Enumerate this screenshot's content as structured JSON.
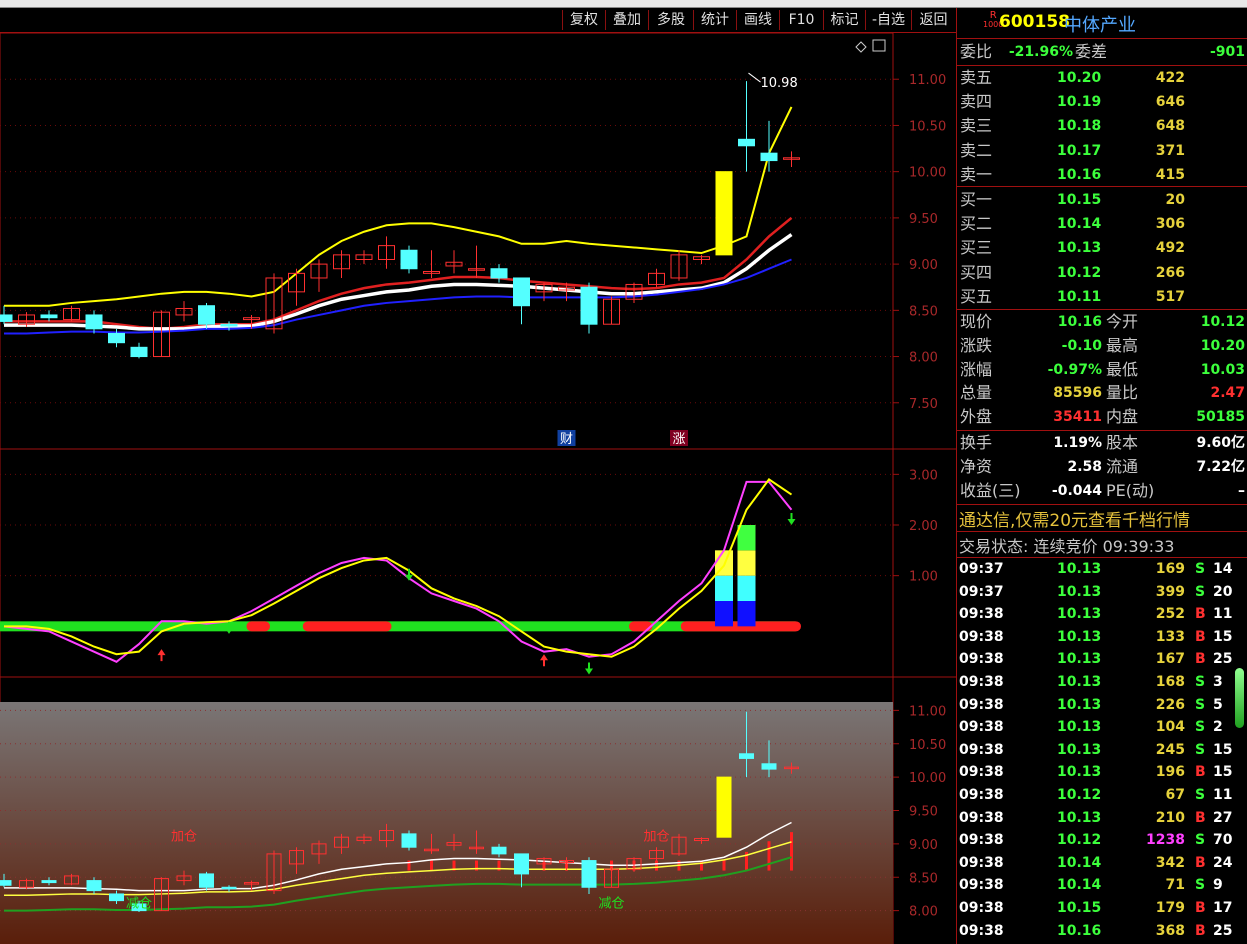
{
  "toolbar": [
    {
      "key": "fuquan",
      "label": "复权"
    },
    {
      "key": "diejia",
      "label": "叠加"
    },
    {
      "key": "duogu",
      "label": "多股"
    },
    {
      "key": "tongji",
      "label": "统计"
    },
    {
      "key": "huaxian",
      "label": "画线"
    },
    {
      "key": "f10",
      "label": "F10"
    },
    {
      "key": "biaoji",
      "label": "标记"
    },
    {
      "key": "zixuan",
      "label": "-自选"
    },
    {
      "key": "fanhui",
      "label": "返回"
    }
  ],
  "stock": {
    "badge_top": "R",
    "badge_bottom": "1000",
    "code": "600158",
    "name": "中体产业"
  },
  "weibi": {
    "label": "委比",
    "value": "-21.96%",
    "label2": "委差",
    "value2": "-901"
  },
  "asks": [
    {
      "label": "卖五",
      "price": "10.20",
      "vol": "422"
    },
    {
      "label": "卖四",
      "price": "10.19",
      "vol": "646"
    },
    {
      "label": "卖三",
      "price": "10.18",
      "vol": "648"
    },
    {
      "label": "卖二",
      "price": "10.17",
      "vol": "371"
    },
    {
      "label": "卖一",
      "price": "10.16",
      "vol": "415"
    }
  ],
  "bids": [
    {
      "label": "买一",
      "price": "10.15",
      "vol": "20"
    },
    {
      "label": "买二",
      "price": "10.14",
      "vol": "306"
    },
    {
      "label": "买三",
      "price": "10.13",
      "vol": "492"
    },
    {
      "label": "买四",
      "price": "10.12",
      "vol": "266"
    },
    {
      "label": "买五",
      "price": "10.11",
      "vol": "517"
    }
  ],
  "quote": [
    {
      "l1": "现价",
      "v1": "10.16",
      "c1": "#3cff3c",
      "l2": "今开",
      "v2": "10.12",
      "c2": "#3cff3c"
    },
    {
      "l1": "涨跌",
      "v1": "-0.10",
      "c1": "#3cff3c",
      "l2": "最高",
      "v2": "10.20",
      "c2": "#3cff3c"
    },
    {
      "l1": "涨幅",
      "v1": "-0.97%",
      "c1": "#3cff3c",
      "l2": "最低",
      "v2": "10.03",
      "c2": "#3cff3c"
    },
    {
      "l1": "总量",
      "v1": "85596",
      "c1": "#e6d23c",
      "l2": "量比",
      "v2": "2.47",
      "c2": "#ff3030"
    },
    {
      "l1": "外盘",
      "v1": "35411",
      "c1": "#ff3030",
      "l2": "内盘",
      "v2": "50185",
      "c2": "#3cff3c"
    }
  ],
  "fundamentals": [
    {
      "l1": "换手",
      "v1": "1.19%",
      "l2": "股本",
      "v2": "9.60亿"
    },
    {
      "l1": "净资",
      "v1": "2.58",
      "l2": "流通",
      "v2": "7.22亿"
    },
    {
      "l1": "收益(三)",
      "v1": "-0.044",
      "l2": "PE(动)",
      "v2": "–"
    }
  ],
  "promo": "通达信,仅需20元查看千档行情",
  "trade_status": "交易状态: 连续竞价 09:39:33",
  "ticks": [
    {
      "t": "09:37",
      "p": "10.13",
      "v": "169",
      "s": "S",
      "n": "14"
    },
    {
      "t": "09:37",
      "p": "10.13",
      "v": "399",
      "s": "S",
      "n": "20"
    },
    {
      "t": "09:38",
      "p": "10.13",
      "v": "252",
      "s": "B",
      "n": "11"
    },
    {
      "t": "09:38",
      "p": "10.13",
      "v": "133",
      "s": "B",
      "n": "15"
    },
    {
      "t": "09:38",
      "p": "10.13",
      "v": "167",
      "s": "B",
      "n": "25"
    },
    {
      "t": "09:38",
      "p": "10.13",
      "v": "168",
      "s": "S",
      "n": "3"
    },
    {
      "t": "09:38",
      "p": "10.13",
      "v": "226",
      "s": "S",
      "n": "5"
    },
    {
      "t": "09:38",
      "p": "10.13",
      "v": "104",
      "s": "S",
      "n": "2"
    },
    {
      "t": "09:38",
      "p": "10.13",
      "v": "245",
      "s": "S",
      "n": "15"
    },
    {
      "t": "09:38",
      "p": "10.13",
      "v": "196",
      "s": "B",
      "n": "15"
    },
    {
      "t": "09:38",
      "p": "10.12",
      "v": "67",
      "s": "S",
      "n": "11"
    },
    {
      "t": "09:38",
      "p": "10.13",
      "v": "210",
      "s": "B",
      "n": "27"
    },
    {
      "t": "09:38",
      "p": "10.12",
      "v": "1238",
      "s": "S",
      "n": "70"
    },
    {
      "t": "09:38",
      "p": "10.14",
      "v": "342",
      "s": "B",
      "n": "24"
    },
    {
      "t": "09:38",
      "p": "10.14",
      "v": "71",
      "s": "S",
      "n": "9"
    },
    {
      "t": "09:38",
      "p": "10.15",
      "v": "179",
      "s": "B",
      "n": "17"
    },
    {
      "t": "09:38",
      "p": "10.16",
      "v": "368",
      "s": "B",
      "n": "25"
    }
  ],
  "colors": {
    "up": "#ff3030",
    "down": "#3cff3c",
    "neutral": "#e6d23c",
    "label": "#c8c8c8",
    "grid_red": "#a01010",
    "cyan": "#54ffff",
    "yellow": "#ffff00",
    "magenta": "#ff40ff",
    "blue_vol": "#ff40ff"
  },
  "chart_data": [
    {
      "type": "candlestick",
      "panel": "main",
      "ylim": [
        7.0,
        11.5
      ],
      "yticks": [
        "11.00",
        "10.50",
        "10.00",
        "9.50",
        "9.00",
        "8.50",
        "8.00",
        "7.50"
      ],
      "max_label": "10.98",
      "event_labels": [
        {
          "label": "财",
          "index": 25
        },
        {
          "label": "涨",
          "index": 30
        }
      ],
      "candles": [
        {
          "o": 8.45,
          "h": 8.55,
          "l": 8.35,
          "c": 8.38
        },
        {
          "o": 8.35,
          "h": 8.48,
          "l": 8.32,
          "c": 8.45
        },
        {
          "o": 8.45,
          "h": 8.5,
          "l": 8.38,
          "c": 8.42
        },
        {
          "o": 8.4,
          "h": 8.55,
          "l": 8.38,
          "c": 8.52
        },
        {
          "o": 8.45,
          "h": 8.5,
          "l": 8.25,
          "c": 8.3
        },
        {
          "o": 8.25,
          "h": 8.3,
          "l": 8.1,
          "c": 8.15
        },
        {
          "o": 8.1,
          "h": 8.15,
          "l": 7.98,
          "c": 8.0
        },
        {
          "o": 8.0,
          "h": 8.5,
          "l": 8.0,
          "c": 8.48
        },
        {
          "o": 8.45,
          "h": 8.6,
          "l": 8.38,
          "c": 8.52
        },
        {
          "o": 8.55,
          "h": 8.58,
          "l": 8.3,
          "c": 8.35
        },
        {
          "o": 8.35,
          "h": 8.38,
          "l": 8.28,
          "c": 8.33
        },
        {
          "o": 8.4,
          "h": 8.45,
          "l": 8.3,
          "c": 8.42
        },
        {
          "o": 8.3,
          "h": 8.9,
          "l": 8.25,
          "c": 8.85
        },
        {
          "o": 8.7,
          "h": 8.95,
          "l": 8.55,
          "c": 8.9
        },
        {
          "o": 8.85,
          "h": 9.05,
          "l": 8.7,
          "c": 9.0
        },
        {
          "o": 8.95,
          "h": 9.15,
          "l": 8.85,
          "c": 9.1
        },
        {
          "o": 9.05,
          "h": 9.15,
          "l": 9.0,
          "c": 9.1
        },
        {
          "o": 9.05,
          "h": 9.3,
          "l": 8.95,
          "c": 9.2
        },
        {
          "o": 9.15,
          "h": 9.2,
          "l": 8.9,
          "c": 8.95
        },
        {
          "o": 8.9,
          "h": 9.15,
          "l": 8.85,
          "c": 8.92
        },
        {
          "o": 8.98,
          "h": 9.15,
          "l": 8.9,
          "c": 9.02
        },
        {
          "o": 8.95,
          "h": 9.2,
          "l": 8.85,
          "c": 8.95
        },
        {
          "o": 8.95,
          "h": 9.0,
          "l": 8.8,
          "c": 8.85
        },
        {
          "o": 8.85,
          "h": 8.8,
          "l": 8.35,
          "c": 8.55
        },
        {
          "o": 8.7,
          "h": 8.8,
          "l": 8.6,
          "c": 8.78
        },
        {
          "o": 8.72,
          "h": 8.8,
          "l": 8.6,
          "c": 8.75
        },
        {
          "o": 8.75,
          "h": 8.8,
          "l": 8.25,
          "c": 8.35
        },
        {
          "o": 8.35,
          "h": 8.65,
          "l": 8.35,
          "c": 8.62
        },
        {
          "o": 8.62,
          "h": 8.8,
          "l": 8.58,
          "c": 8.78
        },
        {
          "o": 8.78,
          "h": 8.95,
          "l": 8.75,
          "c": 8.9
        },
        {
          "o": 8.85,
          "h": 9.15,
          "l": 8.82,
          "c": 9.1
        },
        {
          "o": 9.05,
          "h": 9.1,
          "l": 9.0,
          "c": 9.08
        },
        {
          "o": 9.1,
          "h": 10.0,
          "l": 9.1,
          "c": 10.0
        },
        {
          "o": 10.35,
          "h": 10.98,
          "l": 10.0,
          "c": 10.28
        },
        {
          "o": 10.2,
          "h": 10.55,
          "l": 10.0,
          "c": 10.12
        },
        {
          "o": 10.15,
          "h": 10.22,
          "l": 10.05,
          "c": 10.15
        }
      ],
      "series": [
        {
          "name": "upper",
          "color": "#ffff00",
          "values": [
            8.55,
            8.55,
            8.55,
            8.58,
            8.6,
            8.62,
            8.65,
            8.68,
            8.7,
            8.7,
            8.68,
            8.65,
            8.7,
            8.9,
            9.1,
            9.25,
            9.35,
            9.42,
            9.44,
            9.44,
            9.4,
            9.35,
            9.3,
            9.22,
            9.22,
            9.25,
            9.22,
            9.2,
            9.18,
            9.16,
            9.14,
            9.12,
            9.2,
            9.3,
            10.2,
            10.7
          ]
        },
        {
          "name": "mid-red",
          "color": "#e02020",
          "values": [
            8.38,
            8.38,
            8.38,
            8.38,
            8.38,
            8.35,
            8.32,
            8.3,
            8.32,
            8.35,
            8.35,
            8.35,
            8.4,
            8.5,
            8.6,
            8.68,
            8.74,
            8.78,
            8.8,
            8.83,
            8.86,
            8.86,
            8.85,
            8.82,
            8.8,
            8.78,
            8.76,
            8.74,
            8.73,
            8.74,
            8.78,
            8.8,
            8.85,
            9.05,
            9.3,
            9.5
          ]
        },
        {
          "name": "mid-white",
          "color": "#ffffff",
          "values": [
            8.34,
            8.34,
            8.34,
            8.34,
            8.33,
            8.32,
            8.3,
            8.3,
            8.3,
            8.32,
            8.33,
            8.33,
            8.38,
            8.46,
            8.55,
            8.62,
            8.66,
            8.7,
            8.72,
            8.76,
            8.78,
            8.78,
            8.77,
            8.76,
            8.74,
            8.72,
            8.7,
            8.68,
            8.68,
            8.7,
            8.72,
            8.74,
            8.8,
            8.95,
            9.15,
            9.32
          ]
        },
        {
          "name": "lower-blue",
          "color": "#2020ff",
          "values": [
            8.25,
            8.25,
            8.26,
            8.27,
            8.27,
            8.26,
            8.26,
            8.27,
            8.28,
            8.3,
            8.3,
            8.31,
            8.34,
            8.4,
            8.45,
            8.5,
            8.55,
            8.58,
            8.6,
            8.62,
            8.64,
            8.65,
            8.65,
            8.64,
            8.64,
            8.64,
            8.64,
            8.64,
            8.65,
            8.67,
            8.7,
            8.73,
            8.78,
            8.85,
            8.95,
            9.05
          ]
        }
      ]
    },
    {
      "type": "line",
      "panel": "indicator",
      "ylim": [
        -1.0,
        3.5
      ],
      "yticks": [
        "3.00",
        "2.00",
        "1.00"
      ],
      "baseline": 0.0,
      "series": [
        {
          "name": "fast",
          "color": "#ff40ff",
          "values": [
            0.0,
            -0.05,
            -0.1,
            -0.3,
            -0.5,
            -0.7,
            -0.35,
            0.1,
            0.1,
            0.05,
            0.1,
            0.3,
            0.55,
            0.8,
            1.05,
            1.25,
            1.35,
            1.3,
            0.95,
            0.65,
            0.5,
            0.35,
            0.1,
            -0.3,
            -0.5,
            -0.45,
            -0.6,
            -0.55,
            -0.3,
            0.1,
            0.5,
            0.85,
            1.5,
            2.85,
            2.85,
            2.3
          ]
        },
        {
          "name": "slow",
          "color": "#ffff00",
          "values": [
            0.0,
            0.0,
            -0.05,
            -0.2,
            -0.4,
            -0.55,
            -0.5,
            -0.1,
            0.05,
            0.08,
            0.1,
            0.22,
            0.45,
            0.7,
            0.95,
            1.15,
            1.3,
            1.35,
            1.1,
            0.75,
            0.55,
            0.4,
            0.2,
            -0.1,
            -0.4,
            -0.5,
            -0.55,
            -0.6,
            -0.4,
            -0.05,
            0.35,
            0.7,
            1.2,
            2.3,
            2.9,
            2.6
          ]
        }
      ]
    },
    {
      "type": "candlestick",
      "panel": "lower",
      "ylim": [
        7.5,
        11.5
      ],
      "yticks": [
        "11.00",
        "10.50",
        "10.00",
        "9.50",
        "9.00",
        "8.50",
        "8.00"
      ],
      "annotations": [
        {
          "text": "加仓",
          "index": 8
        },
        {
          "text": "减仓",
          "index": 6
        },
        {
          "text": "加仓",
          "index": 29
        },
        {
          "text": "减仓",
          "index": 27
        }
      ]
    }
  ]
}
